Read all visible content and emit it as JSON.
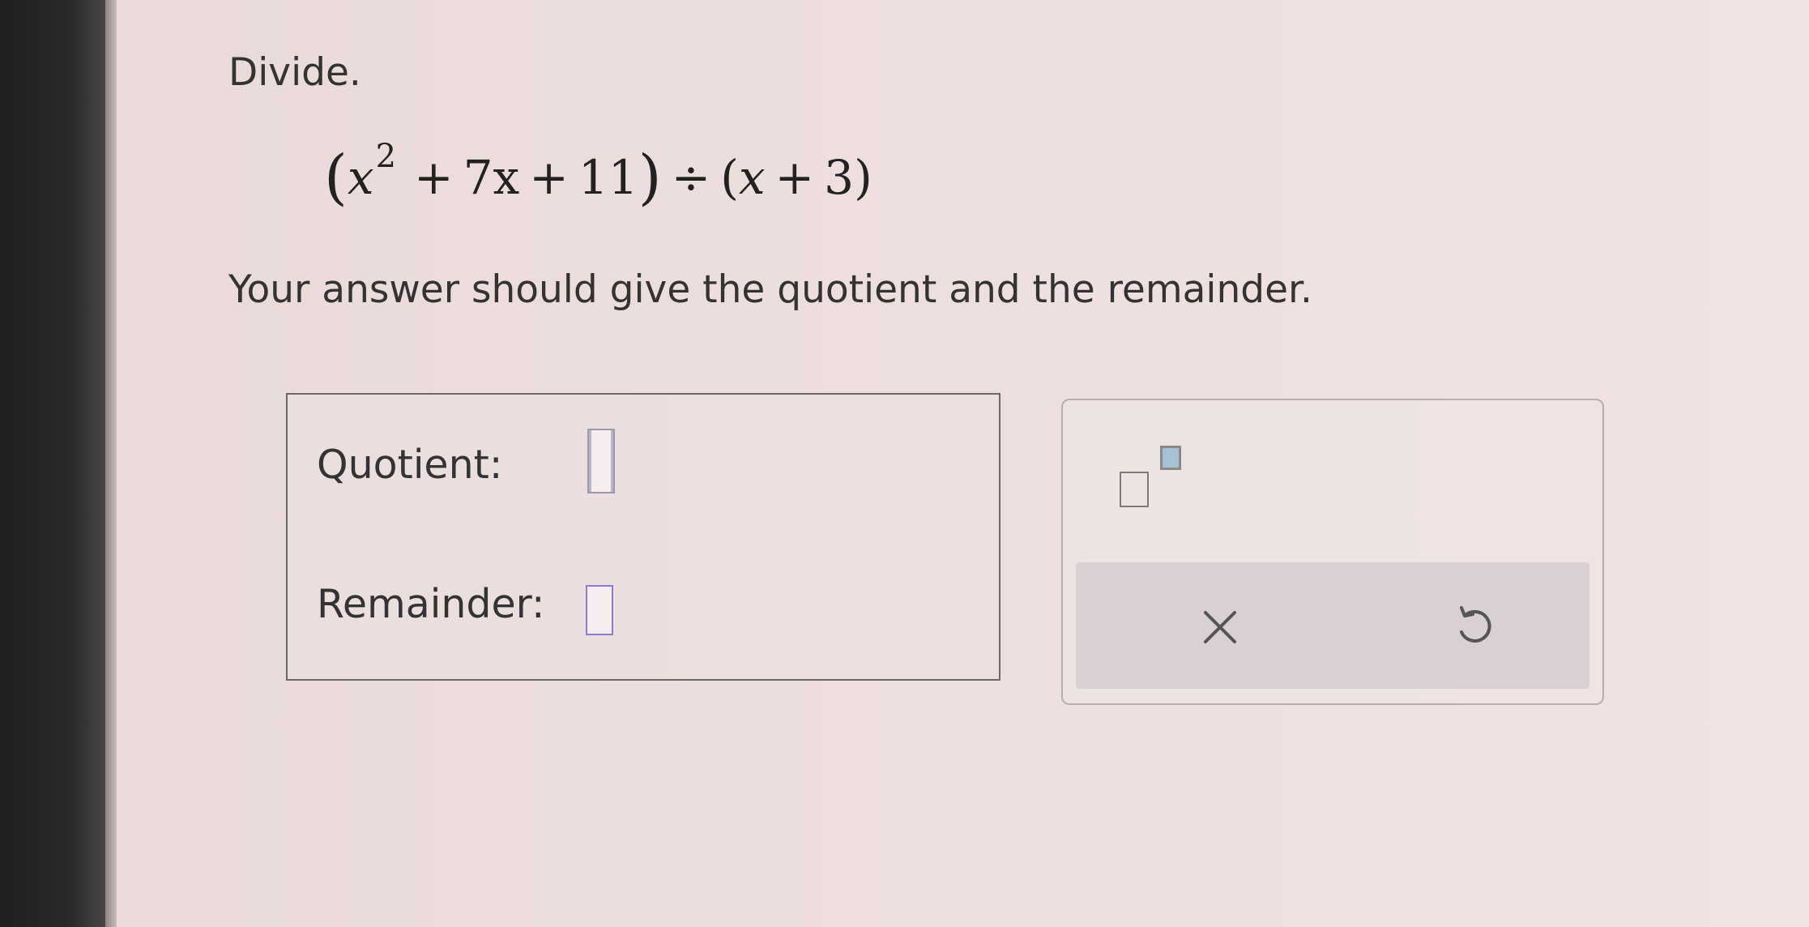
{
  "instructions": {
    "prompt": "Divide.",
    "answer_note": "Your answer should give the quotient and the remainder."
  },
  "expression": {
    "open_paren": "(",
    "term1_var": "x",
    "term1_exp": "2",
    "plus1": "+",
    "term2": "7x",
    "plus2": "+",
    "term3": "11",
    "close_paren": ")",
    "divide_sign": "÷",
    "divisor_open": "(",
    "divisor_var": "x",
    "plus3": "+",
    "divisor_const": "3",
    "divisor_close": ")"
  },
  "answer": {
    "quotient_label": "Quotient:",
    "quotient_value": "",
    "remainder_label": "Remainder:",
    "remainder_value": ""
  },
  "toolbar": {
    "exponent_icon": "exponent-template-icon",
    "clear_icon": "close-icon",
    "undo_icon": "undo-icon",
    "accent_color": "#8a7bd8"
  }
}
